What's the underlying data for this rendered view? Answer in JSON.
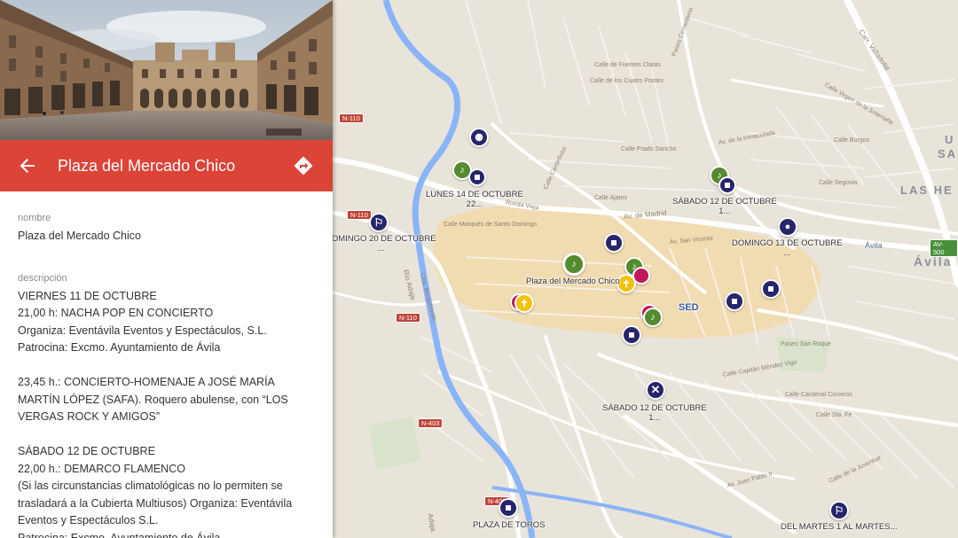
{
  "panel": {
    "title": "Plaza del Mercado Chico",
    "name_label": "nombre",
    "name_value": "Plaza del Mercado Chico",
    "description_label": "descripción",
    "description_lines": [
      "VIERNES 11 DE OCTUBRE",
      "21,00 h: NACHA POP EN CONCIERTO",
      "Organiza: Eventávila Eventos y Espectáculos, S.L.",
      "Patrocina: Excmo. Ayuntamiento de Ávila",
      "",
      "23,45 h.: CONCIERTO-HOMENAJE A JOSÉ MARÍA",
      "MARTÍN LÓPEZ (SAFA). Roquero abulense, con “LOS",
      "VERGAS ROCK Y AMIGOS”",
      "",
      "SÁBADO 12 DE OCTUBRE",
      "22,00 h.: DEMARCO FLAMENCO",
      "(Si las circunstancias climatológicas no lo permiten se",
      "trasladará a la Cubierta Multiusos) Organiza: Eventávila",
      "Eventos y Espectáculos S.L.",
      "Patrocina: Excmo. Ayuntamiento de Ávila"
    ],
    "back_icon": "arrow-back-icon",
    "directions_icon": "directions-icon"
  },
  "map": {
    "marker_labels": {
      "lunes": "LUNES 14 DE OCTUBRE\n22...",
      "sabado12_top": "SÁBADO 12 DE OCTUBRE\n1...",
      "domingo20": "DOMINGO 20 DE OCTUBRE\n...",
      "domingo13": "DOMINGO 13 DE OCTUBRE\n...",
      "plaza": "Plaza del Mercado Chico",
      "sabado12_bottom": "SÁBADO 12 DE OCTUBRE\n1...",
      "plaza_toros": "PLAZA DE TOROS",
      "del_martes": "DEL MARTES 1 AL MARTES..."
    },
    "road_shields": [
      "N-110",
      "N-110",
      "N-110",
      "N-403",
      "N-403",
      "AV-500"
    ],
    "place_labels": {
      "las_he": "LAS HE",
      "sa": "SA",
      "u": "U",
      "avila": "Ávila",
      "avila_big": "Ávila",
      "sed": "SED"
    },
    "street_names": [
      "Paseo Cementerio",
      "Carr. Valladolid",
      "Calle de Fuentes Claras",
      "Calle de los Cuatro Postes",
      "Calle Virgen de la Soterraña",
      "Av. de la Inmaculada",
      "Calle Burgos",
      "Calle Segovia",
      "Calle Prado Sancho",
      "Av. de Madrid",
      "Calle Ajates",
      "Av. San Vicente",
      "Ronda Vieja",
      "Calle Cardeñosa",
      "Río Adaja",
      "Ctra. Burgohondo",
      "Calle Capitán Méndez Vigo",
      "Paseo San Roque",
      "Calle Cardenal Cisneros",
      "Calle Sta. Fe",
      "Av. Juan Pablo II",
      "Calle de la Juventud",
      "Adaja",
      "Calle Marqués de Santo Domingo"
    ],
    "colors": {
      "accent": "#db4437",
      "marker_blue": "#27256b",
      "marker_green": "#558b2f",
      "marker_yellow": "#f4c20d",
      "marker_pink": "#c2185b",
      "map_bg": "#e9e4da",
      "walls_area": "#f2d9a8",
      "river": "#8ab4f8"
    }
  }
}
